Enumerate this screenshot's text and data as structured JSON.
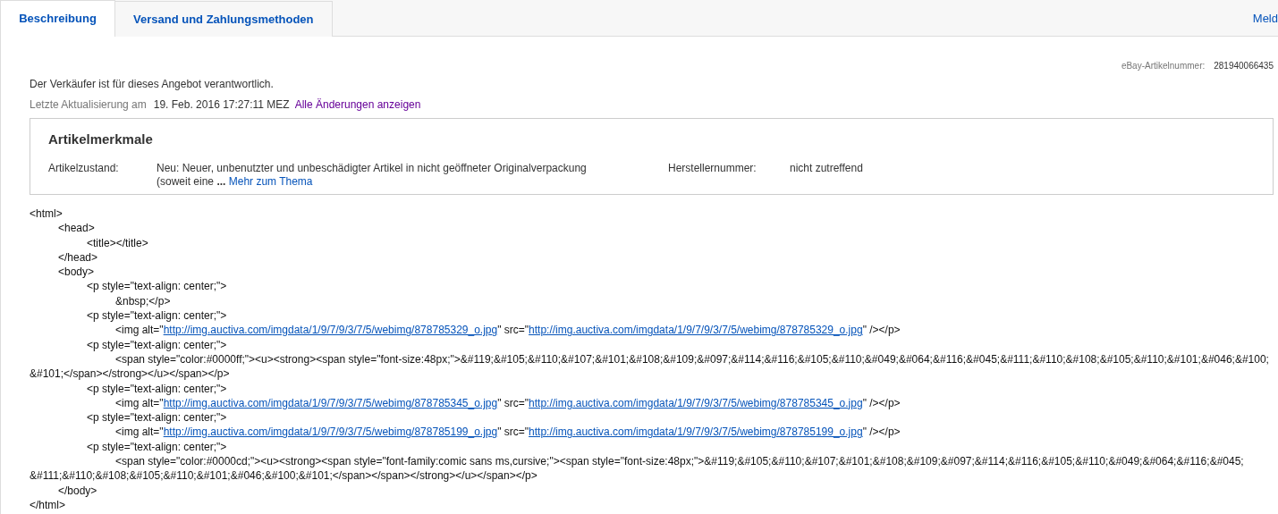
{
  "tabs": [
    {
      "label": "Beschreibung",
      "selected": true
    },
    {
      "label": "Versand und Zahlungsmethoden",
      "selected": false
    }
  ],
  "top_link": "Meld",
  "item_number": {
    "label": "eBay-Artikelnummer:",
    "value": "281940066435"
  },
  "seller_note": "Der Verkäufer ist für dieses Angebot verantwortlich.",
  "last_update": {
    "label": "Letzte Aktualisierung am",
    "value": "19. Feb. 2016 17:27:11 MEZ",
    "link": "Alle Änderungen anzeigen"
  },
  "features": {
    "title": "Artikelmerkmale",
    "rows": [
      {
        "label": "Artikelzustand:",
        "value": "Neu: Neuer, unbenutzter und unbeschädigter Artikel in nicht geöffneter Originalverpackung (soweit eine",
        "ellipsis": "...",
        "link": "Mehr zum Thema"
      },
      {
        "label": "Herstellernummer:",
        "value": "nicht zutreffend"
      }
    ]
  },
  "source": [
    {
      "parts": [
        {
          "kind": "text",
          "text": "<html>"
        }
      ],
      "children": [
        {
          "parts": [
            {
              "kind": "text",
              "text": "<head>"
            }
          ],
          "children": [
            {
              "parts": [
                {
                  "kind": "text",
                  "text": "<title></title>"
                }
              ]
            }
          ]
        },
        {
          "parts": [
            {
              "kind": "text",
              "text": "</head>"
            }
          ]
        },
        {
          "parts": [
            {
              "kind": "text",
              "text": "<body>"
            }
          ],
          "children": [
            {
              "parts": [
                {
                  "kind": "text",
                  "text": "<p style=\"text-align: center;\">"
                }
              ],
              "children": [
                {
                  "parts": [
                    {
                      "kind": "text",
                      "text": "&nbsp;</p>"
                    }
                  ]
                }
              ]
            },
            {
              "parts": [
                {
                  "kind": "text",
                  "text": "<p style=\"text-align: center;\">"
                }
              ],
              "children": [
                {
                  "parts": [
                    {
                      "kind": "text",
                      "text": "<img alt=\""
                    },
                    {
                      "kind": "link",
                      "text": "http://img.auctiva.com/imgdata/1/9/7/9/3/7/5/webimg/878785329_o.jpg"
                    },
                    {
                      "kind": "text",
                      "text": "\" src=\""
                    },
                    {
                      "kind": "link",
                      "text": "http://img.auctiva.com/imgdata/1/9/7/9/3/7/5/webimg/878785329_o.jpg"
                    },
                    {
                      "kind": "text",
                      "text": "\" /></p>"
                    }
                  ]
                }
              ]
            },
            {
              "parts": [
                {
                  "kind": "text",
                  "text": "<p style=\"text-align: center;\">"
                }
              ],
              "children": [
                {
                  "parts": [
                    {
                      "kind": "text",
                      "text": "<span style=\"color:#0000ff;\"><u><strong><span style=\"font-size:48px;\">&#119;&#105;&#110;&#107;&#101;&#108;&#109;&#097;&#114;&#116;&#105;&#110;&#049;&#064;&#116;&#045;&#111;&#110;&#108;&#105;&#110;&#101;&#046;&#100;&#101;</span></strong></u></span></p>"
                    }
                  ]
                }
              ]
            },
            {
              "parts": [
                {
                  "kind": "text",
                  "text": "<p style=\"text-align: center;\">"
                }
              ],
              "children": [
                {
                  "parts": [
                    {
                      "kind": "text",
                      "text": "<img alt=\""
                    },
                    {
                      "kind": "link",
                      "text": "http://img.auctiva.com/imgdata/1/9/7/9/3/7/5/webimg/878785345_o.jpg"
                    },
                    {
                      "kind": "text",
                      "text": "\" src=\""
                    },
                    {
                      "kind": "link",
                      "text": "http://img.auctiva.com/imgdata/1/9/7/9/3/7/5/webimg/878785345_o.jpg"
                    },
                    {
                      "kind": "text",
                      "text": "\" /></p>"
                    }
                  ]
                }
              ]
            },
            {
              "parts": [
                {
                  "kind": "text",
                  "text": "<p style=\"text-align: center;\">"
                }
              ],
              "children": [
                {
                  "parts": [
                    {
                      "kind": "text",
                      "text": "<img alt=\""
                    },
                    {
                      "kind": "link",
                      "text": "http://img.auctiva.com/imgdata/1/9/7/9/3/7/5/webimg/878785199_o.jpg"
                    },
                    {
                      "kind": "text",
                      "text": "\" src=\""
                    },
                    {
                      "kind": "link",
                      "text": "http://img.auctiva.com/imgdata/1/9/7/9/3/7/5/webimg/878785199_o.jpg"
                    },
                    {
                      "kind": "text",
                      "text": "\" /></p>"
                    }
                  ]
                }
              ]
            },
            {
              "parts": [
                {
                  "kind": "text",
                  "text": "<p style=\"text-align: center;\">"
                }
              ],
              "children": [
                {
                  "parts": [
                    {
                      "kind": "text",
                      "text": "<span style=\"color:#0000cd;\"><u><strong><span style=\"font-family:comic sans ms,cursive;\"><span style=\"font-size:48px;\">&#119;&#105;&#110;&#107;&#101;&#108;&#109;&#097;&#114;&#116;&#105;&#110;&#049;&#064;&#116;&#045;&#111;&#110;&#108;&#105;&#110;&#101;&#046;&#100;&#101;</span></span></strong></u></span></p>"
                    }
                  ]
                }
              ]
            }
          ]
        },
        {
          "parts": [
            {
              "kind": "text",
              "text": "</body>"
            }
          ]
        }
      ]
    },
    {
      "parts": [
        {
          "kind": "text",
          "text": "</html>"
        }
      ]
    }
  ]
}
